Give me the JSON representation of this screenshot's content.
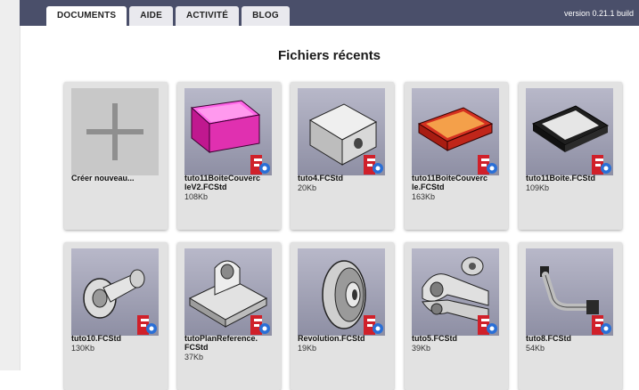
{
  "tabs": [
    {
      "label": "DOCUMENTS",
      "active": true
    },
    {
      "label": "AIDE",
      "active": false
    },
    {
      "label": "ACTIVITÉ",
      "active": false
    },
    {
      "label": "BLOG",
      "active": false
    }
  ],
  "version": "version 0.21.1 build",
  "title": "Fichiers récents",
  "new_file": {
    "label": "Créer nouveau..."
  },
  "files": [
    {
      "name": "tuto11BoiteCouverc\nleV2.FCStd",
      "size": "108Kb",
      "icon": "magenta-box-thumbnail"
    },
    {
      "name": "tuto4.FCStd",
      "size": "20Kb",
      "icon": "hole-block-thumbnail"
    },
    {
      "name": "tuto11BoiteCouverc\nle.FCStd",
      "size": "163Kb",
      "icon": "orange-lid-thumbnail"
    },
    {
      "name": "tuto11Boite.FCStd",
      "size": "109Kb",
      "icon": "tray-thumbnail"
    },
    {
      "name": "tuto10.FCStd",
      "size": "130Kb",
      "icon": "pin-thumbnail"
    },
    {
      "name": "tutoPlanReference.\nFCStd",
      "size": "37Kb",
      "icon": "bracket-thumbnail"
    },
    {
      "name": "Revolution.FCStd",
      "size": "19Kb",
      "icon": "pulley-thumbnail"
    },
    {
      "name": "tuto5.FCStd",
      "size": "39Kb",
      "icon": "clevis-thumbnail"
    },
    {
      "name": "tuto8.FCStd",
      "size": "54Kb",
      "icon": "pipe-thumbnail"
    }
  ],
  "colors": {
    "topbar": "#4a4f6a",
    "card": "#e2e2e2",
    "accent_red": "#d0202a",
    "accent_blue": "#2a6fd6"
  }
}
